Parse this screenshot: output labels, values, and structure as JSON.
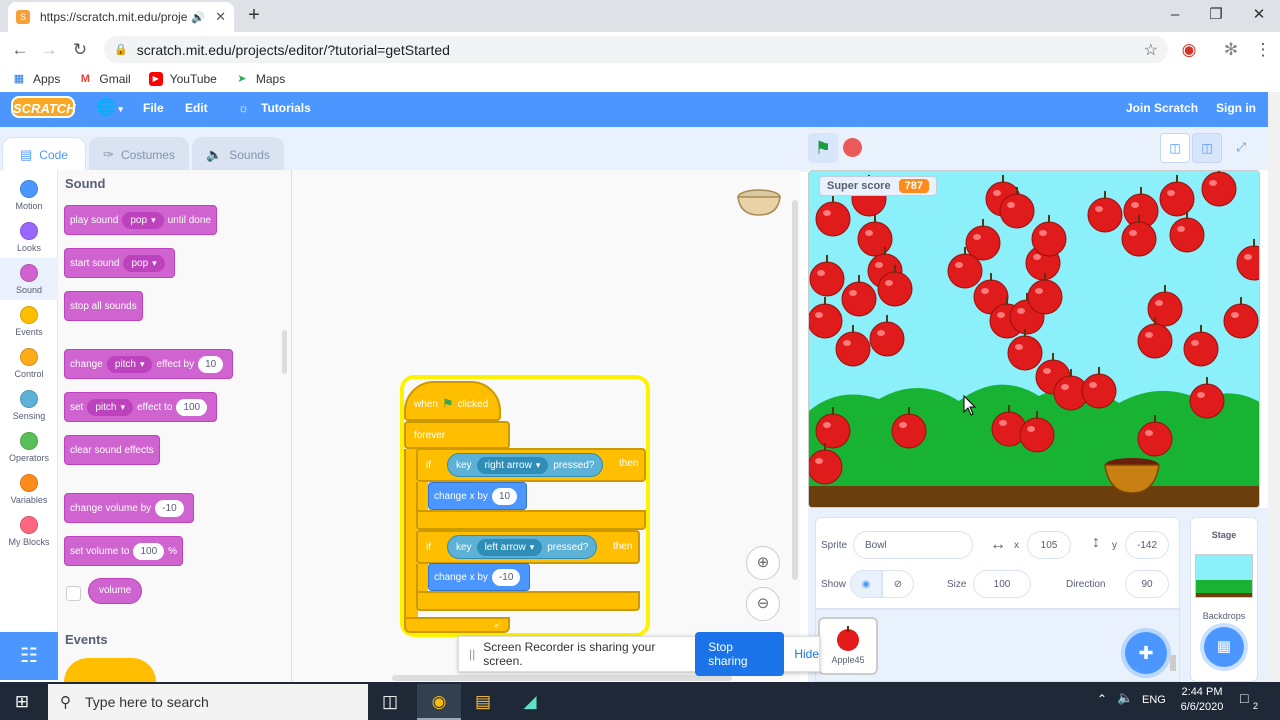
{
  "browser": {
    "tab_title": "https://scratch.mit.edu/proje",
    "new_tab": "+",
    "url": "scratch.mit.edu/projects/editor/?tutorial=getStarted",
    "bookmarks": [
      "Apps",
      "Gmail",
      "YouTube",
      "Maps"
    ]
  },
  "menu": {
    "logo": "SCRATCH",
    "file": "File",
    "edit": "Edit",
    "tutorials": "Tutorials",
    "join": "Join Scratch",
    "signin": "Sign in"
  },
  "tabs": {
    "code": "Code",
    "costumes": "Costumes",
    "sounds": "Sounds"
  },
  "categories": [
    {
      "label": "Motion",
      "color": "#4c97ff"
    },
    {
      "label": "Looks",
      "color": "#9966ff"
    },
    {
      "label": "Sound",
      "color": "#cf63cf"
    },
    {
      "label": "Events",
      "color": "#ffbf00"
    },
    {
      "label": "Control",
      "color": "#ffab19"
    },
    {
      "label": "Sensing",
      "color": "#5cb1d6"
    },
    {
      "label": "Operators",
      "color": "#59c059"
    },
    {
      "label": "Variables",
      "color": "#ff8c1a"
    },
    {
      "label": "My Blocks",
      "color": "#ff6680"
    }
  ],
  "palette": {
    "sound_heading": "Sound",
    "play_sound": "play sound",
    "pop": "pop",
    "until_done": "until done",
    "start_sound": "start sound",
    "stop_all": "stop all sounds",
    "change": "change",
    "pitch": "pitch",
    "effect_by": "effect by",
    "effect_by_val": "10",
    "set": "set",
    "effect_to": "effect to",
    "effect_to_val": "100",
    "clear_effects": "clear sound effects",
    "change_volume": "change volume by",
    "change_volume_val": "-10",
    "set_volume": "set volume to",
    "set_volume_val": "100",
    "percent": "%",
    "volume": "volume",
    "events_heading": "Events"
  },
  "script": {
    "when": "when",
    "clicked": "clicked",
    "forever": "forever",
    "if1": "if",
    "key1": "key",
    "right_arrow": "right arrow",
    "pressed1": "pressed?",
    "then1": "then",
    "change_x1": "change x by",
    "change_x1_val": "10",
    "if2": "if",
    "key2": "key",
    "left_arrow": "left arrow",
    "pressed2": "pressed?",
    "then2": "then",
    "change_x2": "change x by",
    "change_x2_val": "-10"
  },
  "stage": {
    "score_label": "Super score",
    "score_value": "787"
  },
  "sprite_info": {
    "sprite_label": "Sprite",
    "sprite_name": "Bowl",
    "x_label": "x",
    "x_value": "105",
    "y_label": "y",
    "y_value": "-142",
    "show_label": "Show",
    "size_label": "Size",
    "size_value": "100",
    "direction_label": "Direction",
    "direction_value": "90",
    "sprite_tile": "Apple45",
    "stage_label": "Stage",
    "backdrops_label": "Backdrops"
  },
  "recorder": {
    "message": "Screen Recorder is sharing your screen.",
    "stop": "Stop sharing",
    "hide": "Hide"
  },
  "taskbar": {
    "search_placeholder": "Type here to search",
    "lang": "ENG",
    "time": "2:44 PM",
    "date": "6/6/2020",
    "notif_count": "2"
  }
}
